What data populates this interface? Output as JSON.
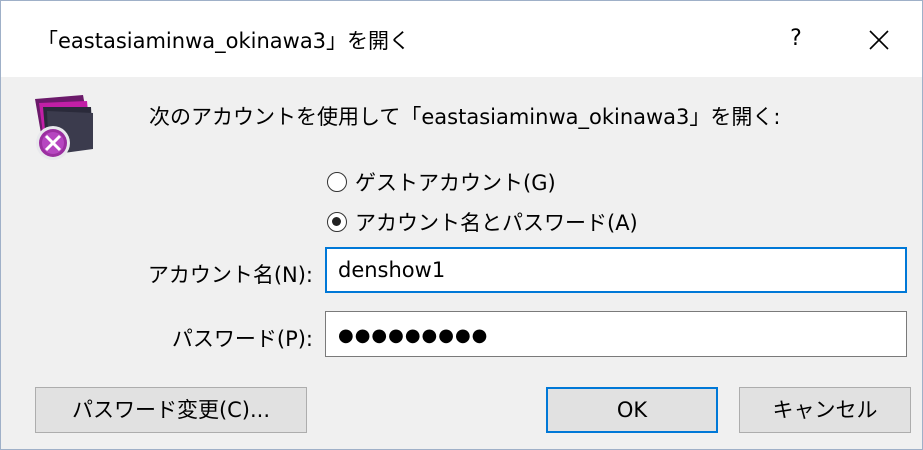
{
  "dialog": {
    "title": "「eastasiaminwa_okinawa3」を開く",
    "help_label": "?",
    "prompt": "次のアカウントを使用して「eastasiaminwa_okinawa3」を開く:"
  },
  "options": {
    "guest_label": "ゲストアカウント(G)",
    "account_label": "アカウント名とパスワード(A)",
    "selected": "account"
  },
  "fields": {
    "account_label": "アカウント名(N):",
    "account_value": "denshow1",
    "password_label": "パスワード(P):",
    "password_masked": "●●●●●●●●●"
  },
  "buttons": {
    "change_password": "パスワード変更(C)...",
    "ok": "OK",
    "cancel": "キャンセル"
  },
  "icons": {
    "title_close": "close-icon",
    "app": "filemaker-app-icon"
  },
  "colors": {
    "accent": "#0078d7",
    "icon_magenta": "#c21fa6",
    "icon_dark": "#2a2a3a"
  }
}
